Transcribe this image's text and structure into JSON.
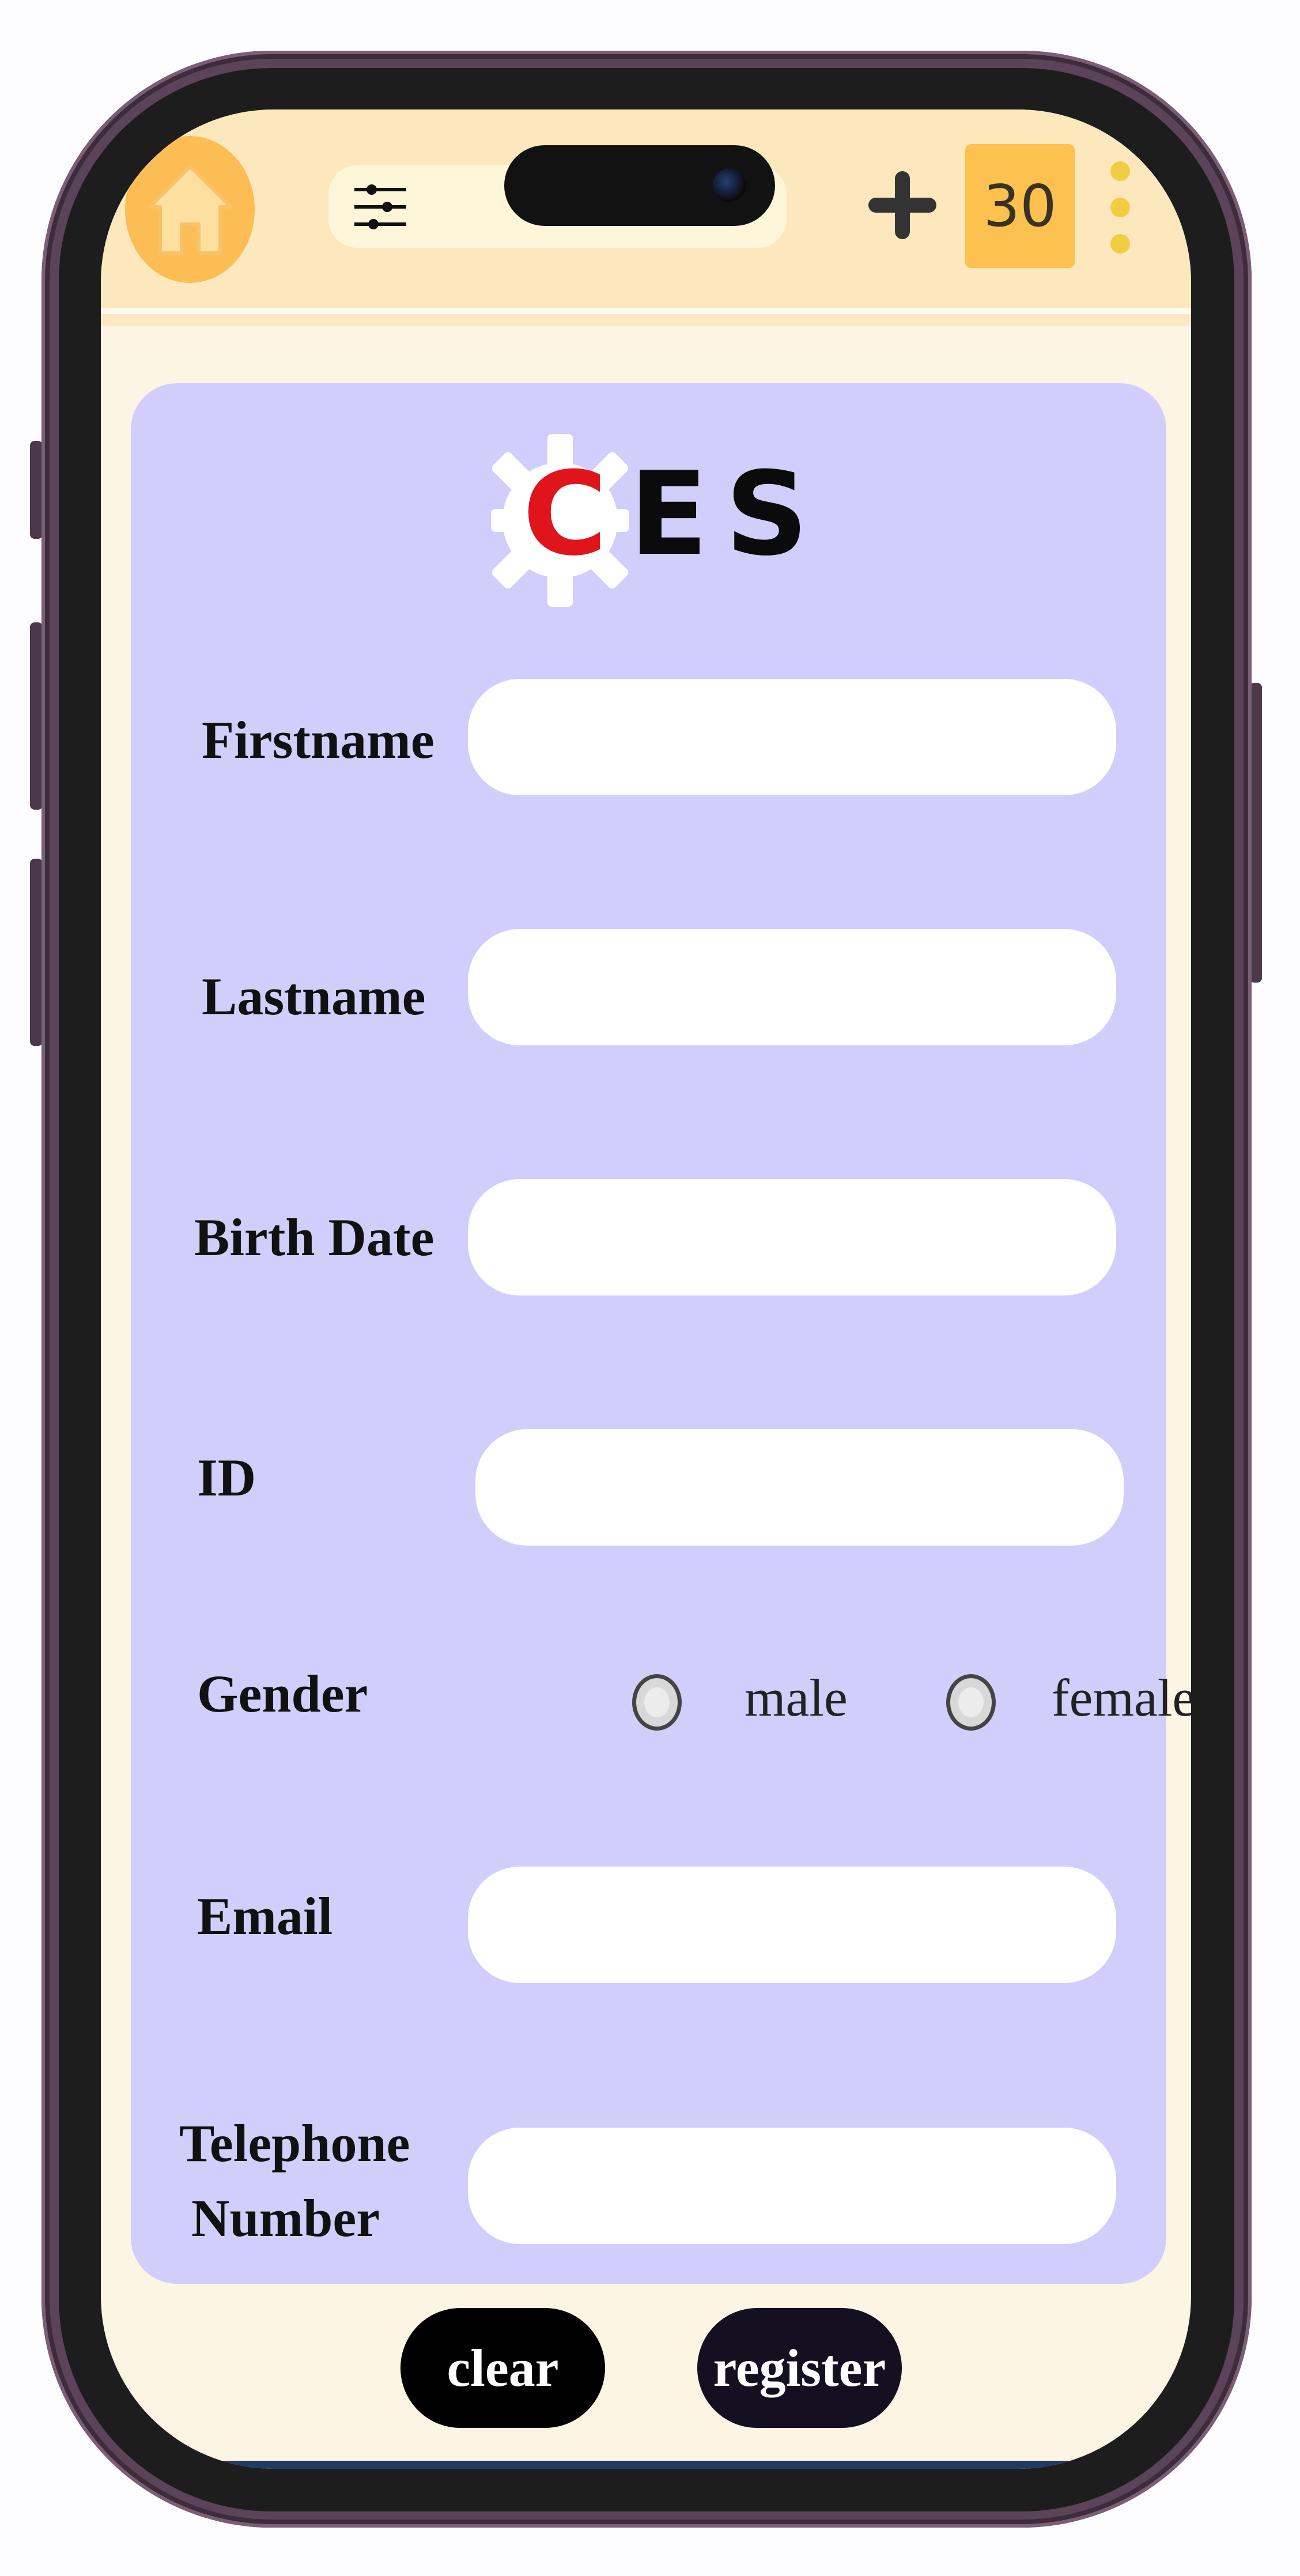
{
  "topbar": {
    "counter": "30"
  },
  "logo": {
    "first_letter": "C",
    "rest": "ES"
  },
  "form": {
    "firstname_label": "Firstname",
    "lastname_label": "Lastname",
    "birthdate_label": "Birth Date",
    "id_label": "ID",
    "gender_label": "Gender",
    "gender_options": [
      "male",
      "female"
    ],
    "email_label": "Email",
    "telephone_label_line1": "Telephone",
    "telephone_label_line2": "Number"
  },
  "actions": {
    "clear_label": "clear",
    "register_label": "register"
  },
  "colors": {
    "topbar": "#fde8bd",
    "screen_bg": "#fdf5e3",
    "card_bg": "#d1cefc",
    "accent_orange": "#fcbd55",
    "counter_bg": "#fcc14e",
    "logo_red": "#e0151b",
    "button_dark": "#000000"
  },
  "icons": [
    "home-icon",
    "filter-icon",
    "plus-icon",
    "more-vertical-icon",
    "gear-logo-icon"
  ]
}
